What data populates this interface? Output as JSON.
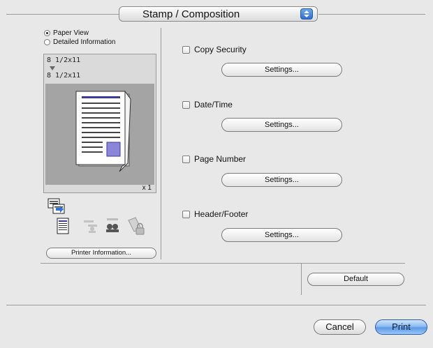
{
  "popup": {
    "label": "Stamp / Composition"
  },
  "view_options": [
    {
      "label": "Paper View",
      "selected": true
    },
    {
      "label": "Detailed Information",
      "selected": false
    }
  ],
  "preview": {
    "original_size": "8 1/2x11",
    "output_size": "8 1/2x11",
    "copies": "x 1"
  },
  "printer_info_button": "Printer Information...",
  "options": [
    {
      "label": "Copy Security",
      "checked": false,
      "button": "Settings..."
    },
    {
      "label": "Date/Time",
      "checked": false,
      "button": "Settings..."
    },
    {
      "label": "Page Number",
      "checked": false,
      "button": "Settings..."
    },
    {
      "label": "Header/Footer",
      "checked": false,
      "button": "Settings..."
    }
  ],
  "default_button": "Default",
  "cancel_button": "Cancel",
  "print_button": "Print",
  "colors": {
    "accent": "#5d9ae6",
    "preview_bg": "#a4a4a4"
  }
}
